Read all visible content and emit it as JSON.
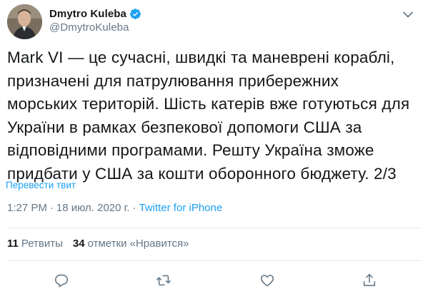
{
  "user": {
    "display_name": "Dmytro Kuleba",
    "handle": "@DmytroKuleba",
    "verified": true
  },
  "tweet": {
    "text": "Mark VI — це сучасні, швидкі та маневрені кораблі,\nпризначені для патрулювання прибережних\nморських територій. Шість катерів вже готуються для\nУкраїни в рамках безпекової допомоги США за\nвідповідними програмами. Решту Україна зможе\nпридбати у США за кошти оборонного бюджету. 2/3",
    "translate_label": "Перевести твит",
    "time": "1:27 PM",
    "separator": "·",
    "date": "18 июл. 2020 г.",
    "source": "Twitter for iPhone"
  },
  "stats": {
    "retweets_count": "11",
    "retweets_label": "Ретвиты",
    "likes_count": "34",
    "likes_label": "отметки «Нравится»"
  },
  "icons": {
    "more": "chevron-down-icon",
    "verified": "verified-badge-icon",
    "reply": "reply-icon",
    "retweet": "retweet-icon",
    "like": "heart-icon",
    "share": "share-icon"
  },
  "colors": {
    "accent": "#1da1f2",
    "text": "#14171a",
    "secondary": "#657786",
    "divider": "#e6ecf0"
  }
}
